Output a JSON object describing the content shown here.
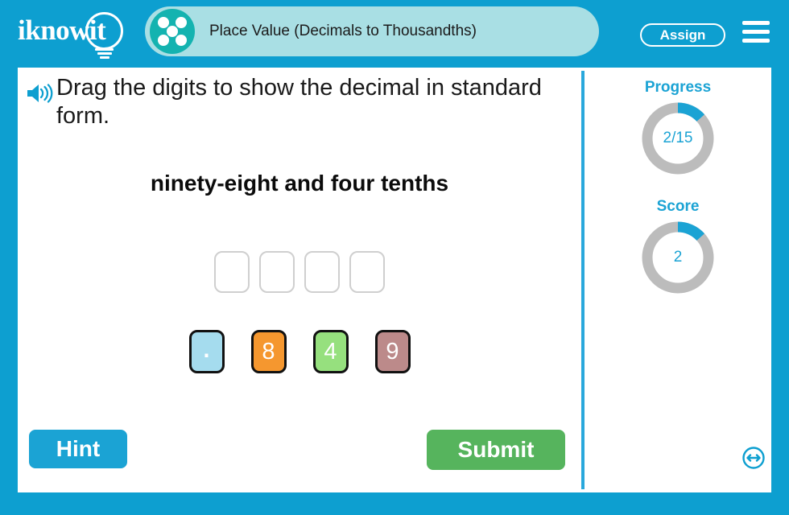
{
  "header": {
    "logo_text": "iknowit",
    "logo_icon": "lightbulb-icon",
    "title": "Place Value (Decimals to Thousandths)",
    "title_icon": "five-dots-circle-icon",
    "assign_label": "Assign",
    "menu_icon": "hamburger-menu-icon",
    "background_color": "#0d9fd0",
    "pill_color": "#a9dfe4",
    "title_icon_color": "#14b3b0"
  },
  "question": {
    "speaker_icon": "speaker-audio-icon",
    "instruction": "Drag the digits to show the decimal in standard form.",
    "prompt": "ninety-eight and four tenths",
    "slot_count": 4,
    "slots": [
      "",
      "",
      "",
      ""
    ],
    "tiles": [
      {
        "label": ".",
        "color": "#a5dcee",
        "name": "decimal-point"
      },
      {
        "label": "8",
        "color": "#f5972f",
        "name": "digit-8"
      },
      {
        "label": "4",
        "color": "#96e07e",
        "name": "digit-4"
      },
      {
        "label": "9",
        "color": "#bc8a8a",
        "name": "digit-9"
      }
    ]
  },
  "actions": {
    "hint_label": "Hint",
    "hint_color": "#1ba3d4",
    "submit_label": "Submit",
    "submit_color": "#56b45d"
  },
  "panel": {
    "progress": {
      "label": "Progress",
      "value": "2/15",
      "current": 2,
      "total": 15,
      "percent": 13.3
    },
    "score": {
      "label": "Score",
      "value": "2",
      "percent": 13.3
    },
    "accent_color": "#1ba3d4",
    "track_color": "#bcbcbc",
    "resize_icon": "resize-horizontal-icon"
  }
}
